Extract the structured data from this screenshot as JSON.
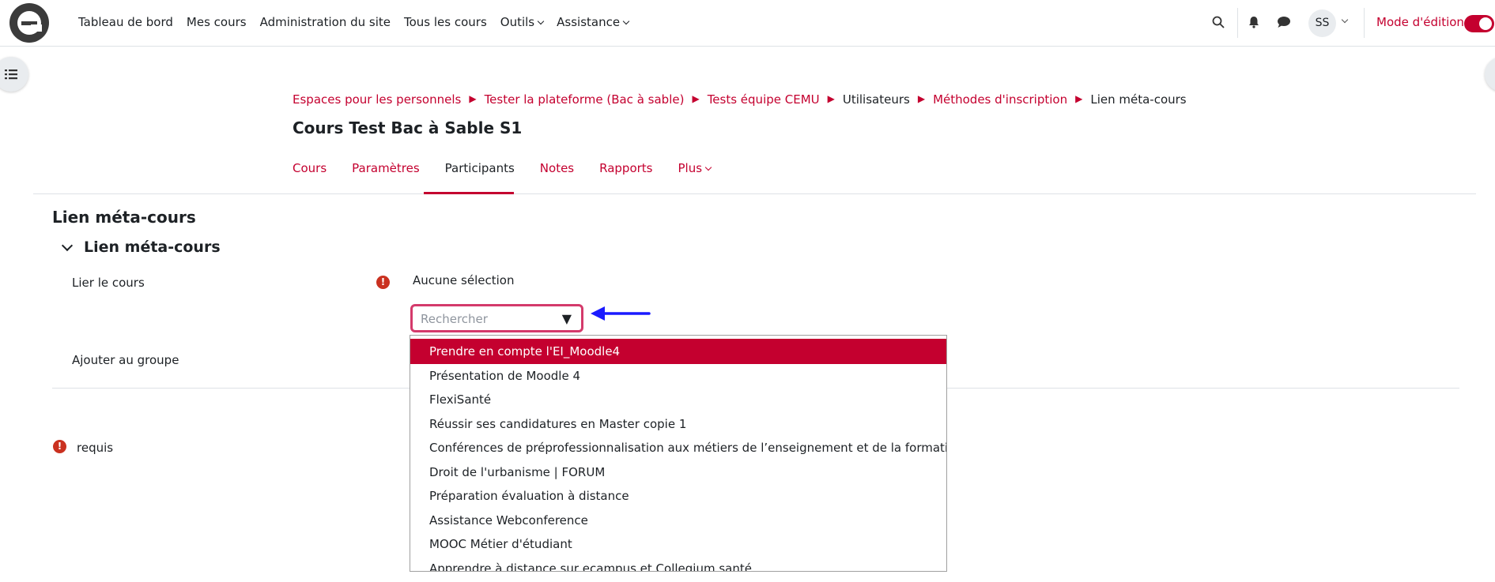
{
  "navbar": {
    "items": [
      "Tableau de bord",
      "Mes cours",
      "Administration du site",
      "Tous les cours",
      "Outils",
      "Assistance"
    ],
    "avatar_initials": "SS",
    "edit_mode_label": "Mode d'édition",
    "edit_mode_on": true
  },
  "breadcrumb": [
    {
      "label": "Espaces pour les personnels",
      "link": true
    },
    {
      "label": "Tester la plateforme (Bac à sable)",
      "link": true
    },
    {
      "label": "Tests équipe CEMU",
      "link": true
    },
    {
      "label": "Utilisateurs",
      "link": false
    },
    {
      "label": "Méthodes d'inscription",
      "link": true
    },
    {
      "label": "Lien méta-cours",
      "link": false
    }
  ],
  "course_title": "Cours Test Bac à Sable S1",
  "tabs": [
    "Cours",
    "Paramètres",
    "Participants",
    "Notes",
    "Rapports",
    "Plus"
  ],
  "active_tab": "Participants",
  "page_heading": "Lien méta-cours",
  "section_heading": "Lien méta-cours",
  "form": {
    "link_course_label": "Lier le cours",
    "no_selection": "Aucune sélection",
    "search_placeholder": "Rechercher",
    "add_group_label": "Ajouter au groupe",
    "required_note": "requis",
    "required_icon": "!"
  },
  "dropdown_options": [
    "Prendre en compte l'EI_Moodle4",
    "Présentation de Moodle 4",
    "FlexiSanté",
    "Réussir ses candidatures en Master copie 1",
    "Conférences de préprofessionnalisation aux métiers de l’enseignement et de la formation",
    "Droit de l'urbanisme | FORUM",
    "Préparation évaluation à distance",
    "Assistance Webconference",
    "MOOC Métier d'étudiant",
    "Apprendre à distance sur ecampus et Collegium santé"
  ],
  "selected_option_index": 0,
  "colors": {
    "accent": "#c4002f",
    "arrow": "#1a1aff",
    "required": "#ca3120"
  }
}
